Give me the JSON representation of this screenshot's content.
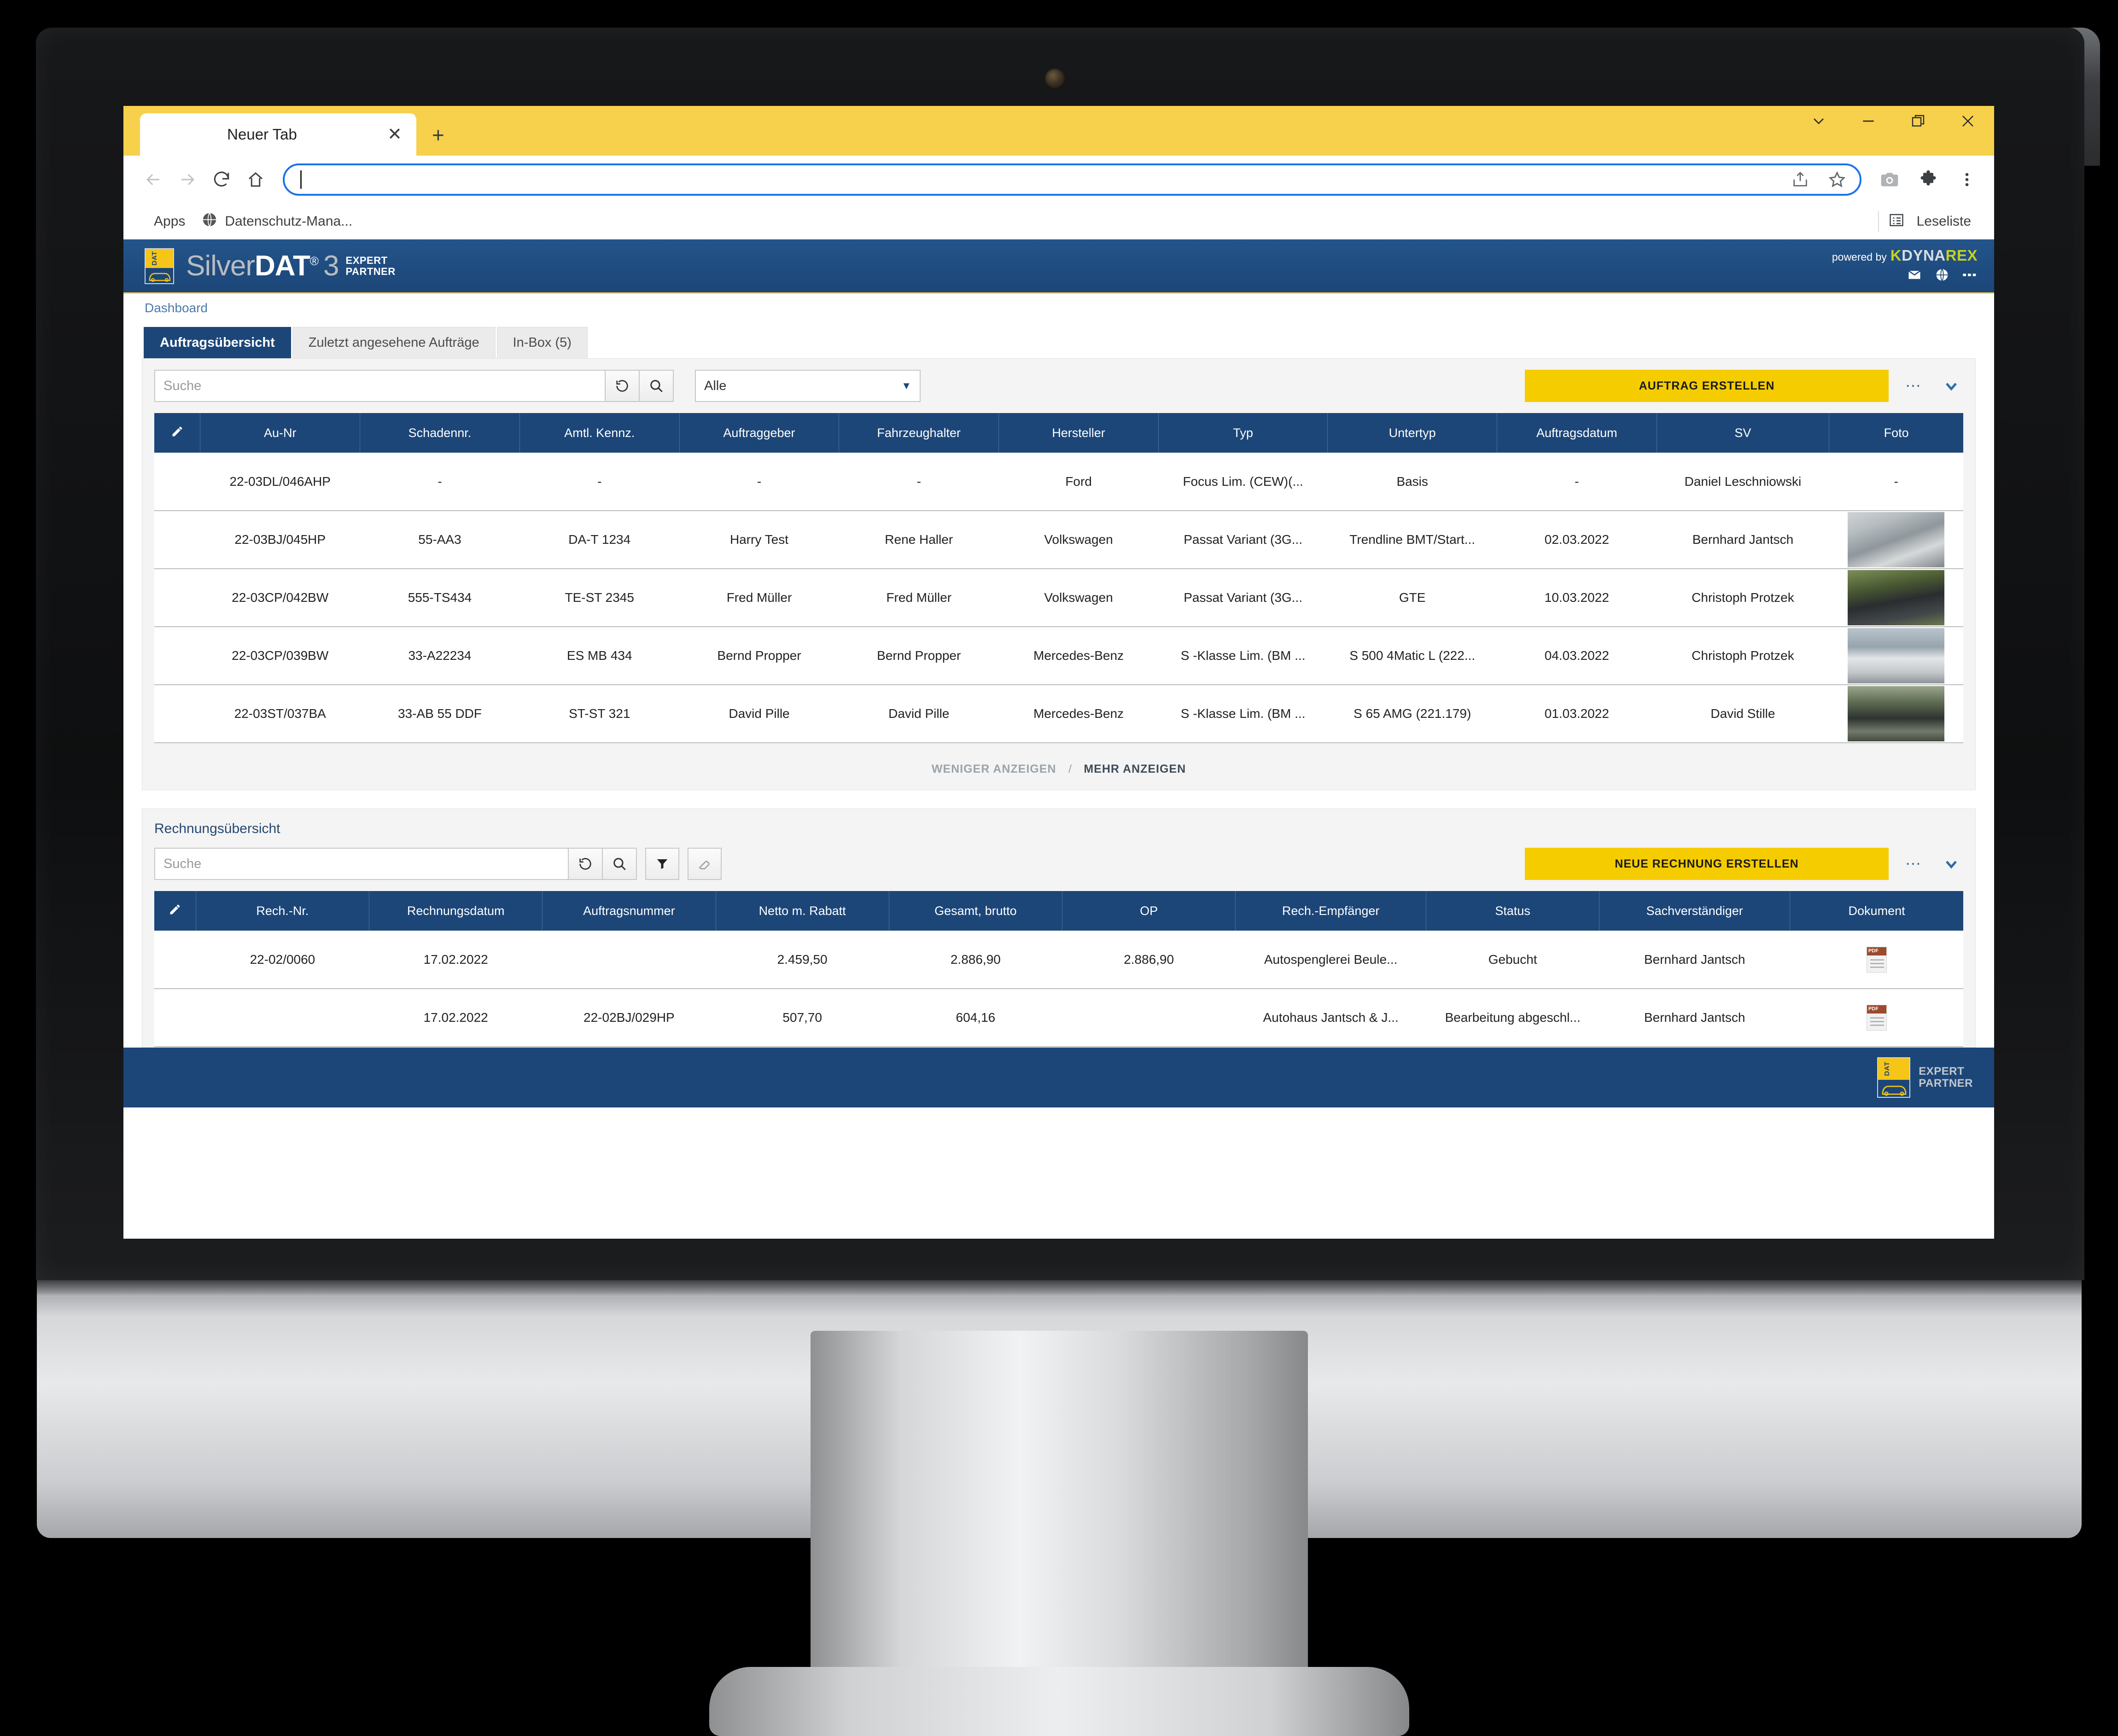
{
  "browser": {
    "tab_title": "Neuer Tab",
    "tab_close_icon": "close-icon",
    "new_tab_icon": "plus-icon",
    "window_controls": [
      "chevron-down-icon",
      "minimize-icon",
      "restore-icon",
      "close-icon"
    ],
    "nav": {
      "back_icon": "arrow-left-icon",
      "forward_icon": "arrow-right-icon",
      "reload_icon": "reload-icon",
      "home_icon": "home-icon"
    },
    "omnibox": {
      "value": "",
      "placeholder": ""
    },
    "omnibox_actions": [
      "share-icon",
      "star-icon"
    ],
    "toolbar_actions": [
      "camera-icon",
      "extensions-puzzle-icon",
      "more-vertical-icon"
    ],
    "bookmarks": {
      "apps_label": "Apps",
      "items": [
        {
          "label": "Datenschutz-Mana...",
          "icon": "globe-icon"
        }
      ],
      "reading_list_label": "Leseliste",
      "reading_list_icon": "reading-list-icon"
    }
  },
  "app": {
    "brand": {
      "silver": "Silver",
      "dat": "DAT",
      "registered": "®",
      "three": "3",
      "expert_line1": "EXPERT",
      "expert_line2": "PARTNER",
      "logo_word": "DAT"
    },
    "powered_by": "powered by",
    "dynarex": {
      "mark": "K",
      "dyna": "DYNA",
      "rex": "REX"
    },
    "header_icons": [
      "mail-icon",
      "globe-icon",
      "more-horizontal-icon"
    ],
    "breadcrumb": "Dashboard",
    "tabs": [
      {
        "label": "Auftragsübersicht",
        "active": true
      },
      {
        "label": "Zuletzt angesehene Aufträge",
        "active": false
      },
      {
        "label": "In-Box (5)",
        "active": false
      }
    ],
    "colors": {
      "header_blue": "#1c4678",
      "accent_yellow": "#f5cc00",
      "tab_strip_yellow": "#f7d14c",
      "link_blue": "#4a7ba8"
    }
  },
  "orders": {
    "search_placeholder": "Suche",
    "search_value": "",
    "reset_icon": "reset-icon",
    "search_icon": "search-icon",
    "filter_value": "Alle",
    "create_button": "AUFTRAG ERSTELLEN",
    "overflow_icon": "dots-icon",
    "collapse_icon": "chevron-down-icon",
    "columns": [
      "",
      "Au-Nr",
      "Schadennr.",
      "Amtl. Kennz.",
      "Auftraggeber",
      "Fahrzeughalter",
      "Hersteller",
      "Typ",
      "Untertyp",
      "Auftragsdatum",
      "SV",
      "Foto"
    ],
    "rows": [
      {
        "au_nr": "22-03DL/046AHP",
        "schadennr": "-",
        "kennz": "-",
        "auftraggeber": "-",
        "halter": "-",
        "hersteller": "Ford",
        "typ": "Focus Lim. (CEW)(...",
        "untertyp": "Basis",
        "datum": "-",
        "sv": "Daniel Leschniowski",
        "foto": "-",
        "thumb": ""
      },
      {
        "au_nr": "22-03BJ/045HP",
        "schadennr": "55-AA3",
        "kennz": "DA-T 1234",
        "auftraggeber": "Harry Test",
        "halter": "Rene Haller",
        "hersteller": "Volkswagen",
        "typ": "Passat Variant (3G...",
        "untertyp": "Trendline BMT/Start...",
        "datum": "02.03.2022",
        "sv": "Bernhard Jantsch",
        "foto": "",
        "thumb": "thumb-a"
      },
      {
        "au_nr": "22-03CP/042BW",
        "schadennr": "555-TS434",
        "kennz": "TE-ST 2345",
        "auftraggeber": "Fred Müller",
        "halter": "Fred Müller",
        "hersteller": "Volkswagen",
        "typ": "Passat Variant (3G...",
        "untertyp": "GTE",
        "datum": "10.03.2022",
        "sv": "Christoph Protzek",
        "foto": "",
        "thumb": "thumb-b"
      },
      {
        "au_nr": "22-03CP/039BW",
        "schadennr": "33-A22234",
        "kennz": "ES MB 434",
        "auftraggeber": "Bernd Propper",
        "halter": "Bernd Propper",
        "hersteller": "Mercedes-Benz",
        "typ": "S -Klasse Lim. (BM ...",
        "untertyp": "S 500 4Matic L (222...",
        "datum": "04.03.2022",
        "sv": "Christoph Protzek",
        "foto": "",
        "thumb": "thumb-c"
      },
      {
        "au_nr": "22-03ST/037BA",
        "schadennr": "33-AB 55 DDF",
        "kennz": "ST-ST 321",
        "auftraggeber": "David Pille",
        "halter": "David Pille",
        "hersteller": "Mercedes-Benz",
        "typ": "S -Klasse Lim. (BM ...",
        "untertyp": "S 65 AMG (221.179)",
        "datum": "01.03.2022",
        "sv": "David Stille",
        "foto": "",
        "thumb": "thumb-d"
      }
    ],
    "show_less": "WENIGER ANZEIGEN",
    "separator": "/",
    "show_more": "MEHR ANZEIGEN"
  },
  "invoices": {
    "title": "Rechnungsübersicht",
    "search_placeholder": "Suche",
    "search_value": "",
    "reset_icon": "reset-icon",
    "search_icon": "search-icon",
    "filter_icon": "funnel-icon",
    "clear_icon": "eraser-icon",
    "create_button": "NEUE RECHNUNG ERSTELLEN",
    "overflow_icon": "dots-icon",
    "collapse_icon": "chevron-down-icon",
    "columns": [
      "",
      "Rech.-Nr.",
      "Rechnungsdatum",
      "Auftragsnummer",
      "Netto m. Rabatt",
      "Gesamt, brutto",
      "OP",
      "Rech.-Empfänger",
      "Status",
      "Sachverständiger",
      "Dokument"
    ],
    "rows": [
      {
        "rech_nr": "22-02/0060",
        "datum": "17.02.2022",
        "auftragsnummer": "",
        "netto": "2.459,50",
        "brutto": "2.886,90",
        "op": "2.886,90",
        "empfaenger": "Autospenglerei Beule...",
        "status": "Gebucht",
        "sachverstaendiger": "Bernhard Jantsch",
        "dokument": "pdf-icon"
      },
      {
        "rech_nr": "",
        "datum": "17.02.2022",
        "auftragsnummer": "22-02BJ/029HP",
        "netto": "507,70",
        "brutto": "604,16",
        "op": "",
        "empfaenger": "Autohaus Jantsch & J...",
        "status": "Bearbeitung abgeschl...",
        "sachverstaendiger": "Bernhard Jantsch",
        "dokument": "pdf-icon"
      }
    ]
  },
  "footer": {
    "expert_line1": "EXPERT",
    "expert_line2": "PARTNER",
    "logo_word": "DAT"
  }
}
